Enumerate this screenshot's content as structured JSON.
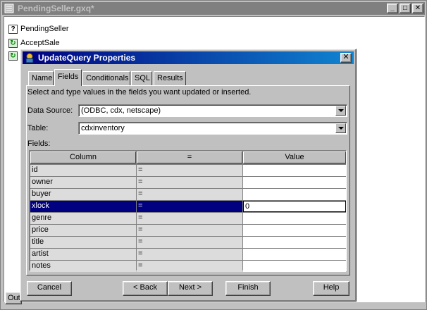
{
  "back_window": {
    "title": "PendingSeller.gxq*",
    "controls": {
      "minimize": "_",
      "maximize": "□",
      "close": "✕"
    },
    "tree_items": [
      {
        "label": "PendingSeller",
        "icon": "query-icon"
      },
      {
        "label": "AcceptSale",
        "icon": "refresh-icon"
      },
      {
        "label": "",
        "icon": "refresh-icon"
      }
    ],
    "status_tab": "Out"
  },
  "dialog": {
    "title": "UpdateQuery Properties",
    "close": "✕",
    "tabs": [
      "Name",
      "Fields",
      "Conditionals",
      "SQL",
      "Results"
    ],
    "active_tab": "Fields",
    "instruction": "Select and type values in the fields you want updated or inserted.",
    "data_source_label": "Data Source:",
    "data_source_value": "(ODBC, cdx, netscape)",
    "table_label": "Table:",
    "table_value": "cdxinventory",
    "fields_label": "Fields:",
    "grid": {
      "headers": [
        "Column",
        "=",
        "Value"
      ],
      "rows": [
        {
          "column": "id",
          "op": "=",
          "value": ""
        },
        {
          "column": "owner",
          "op": "=",
          "value": ""
        },
        {
          "column": "buyer",
          "op": "=",
          "value": ""
        },
        {
          "column": "xlock",
          "op": "=",
          "value": "0"
        },
        {
          "column": "genre",
          "op": "=",
          "value": ""
        },
        {
          "column": "price",
          "op": "=",
          "value": ""
        },
        {
          "column": "title",
          "op": "=",
          "value": ""
        },
        {
          "column": "artist",
          "op": "=",
          "value": ""
        },
        {
          "column": "notes",
          "op": "=",
          "value": ""
        }
      ],
      "selected_row": 3
    },
    "buttons": {
      "cancel": "Cancel",
      "back": "< Back",
      "next": "Next >",
      "finish": "Finish",
      "help": "Help"
    }
  },
  "colors": {
    "face": "#c0c0c0",
    "active_title": "#000080",
    "inactive_title": "#808080",
    "selection": "#000080"
  }
}
